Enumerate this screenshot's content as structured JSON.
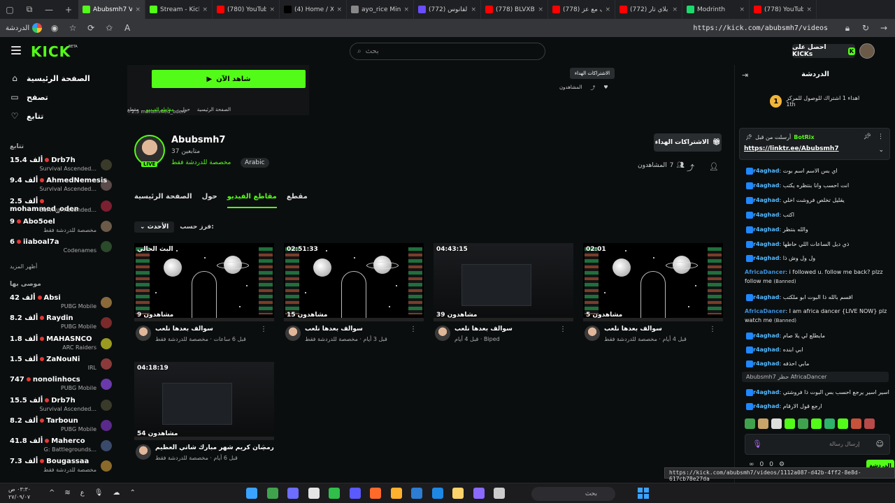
{
  "browser": {
    "tabs": [
      {
        "title": "Abubsmh7 Videos",
        "color": "#53fc18",
        "active": true
      },
      {
        "title": "Stream - Kick Dash",
        "color": "#53fc18",
        "active": false
      },
      {
        "title": "(780) YouTube",
        "color": "#ff0000",
        "active": false
      },
      {
        "title": "(4) Home / X",
        "color": "#000000",
        "active": false
      },
      {
        "title": "ayo_rice Minecraft",
        "color": "#888888",
        "active": false
      },
      {
        "title": "القانوس (772)",
        "color": "#6a4dff",
        "active": false
      },
      {
        "title": "(778) BLVXB - MU",
        "color": "#ff0000",
        "active": false
      },
      {
        "title": "(778) حروف مع عز",
        "color": "#ff0000",
        "active": false
      },
      {
        "title": "(772) بوبي بلاي تار",
        "color": "#ff0000",
        "active": false
      },
      {
        "title": "Modrinth",
        "color": "#1bd96a",
        "active": false
      },
      {
        "title": "(778) YouTube",
        "color": "#ff0000",
        "active": false
      }
    ],
    "profile_label": "الدردشة",
    "url": "https://kick.com/abubsmh7/videos",
    "status_url": "https://kick.com/abubsmh7/videos/1112a087-d42b-4ff2-8e8d-617cb78e27da"
  },
  "header": {
    "logo": "KICK",
    "beta": "BETA",
    "search_placeholder": "بحث",
    "kicks_label": "احصل على KICKs"
  },
  "sidebar": {
    "nav": [
      {
        "label": "الصفحة الرئيسية",
        "icon": "home-icon",
        "glyph": "⌂"
      },
      {
        "label": "تصفح",
        "icon": "browse-icon",
        "glyph": "▭"
      },
      {
        "label": "تتابع",
        "icon": "heart-icon",
        "glyph": "♡"
      }
    ],
    "following_title": "تتابع",
    "following": [
      {
        "name": "Drb7h",
        "viewers": "15.4 ألف",
        "category": "Survival Ascended...",
        "avatar": "#3a3a2a"
      },
      {
        "name": "AhmedNemesis",
        "viewers": "9.4 ألف",
        "category": "Survival Ascended...",
        "avatar": "#5a4a4a"
      },
      {
        "name": "mohammed_oden",
        "viewers": "2.5 ألف",
        "category": "Survival Ascended...",
        "avatar": "#7a2030"
      },
      {
        "name": "Abo5oel",
        "viewers": "9",
        "category": "مخصصة للدردشة فقط",
        "avatar": "#6b5a48"
      },
      {
        "name": "iiaboal7a",
        "viewers": "6",
        "category": "Codenames",
        "avatar": "#2a4a2a"
      }
    ],
    "show_more": "أظهر المزيد",
    "recommended_title": "موصى بها",
    "recommended": [
      {
        "name": "Absi",
        "viewers": "42 ألف",
        "category": "PUBG Mobile",
        "avatar": "#8a6a3a"
      },
      {
        "name": "Raydin",
        "viewers": "8.2 ألف",
        "category": "PUBG Mobile",
        "avatar": "#7a2a2a"
      },
      {
        "name": "MAHASNCO",
        "viewers": "1.8 ألف",
        "category": "ARC Raiders",
        "avatar": "#9a9a20"
      },
      {
        "name": "ZaNouNi",
        "viewers": "1.5 ألف",
        "category": "IRL",
        "avatar": "#8a3a3a"
      },
      {
        "name": "nonolinhocs",
        "viewers": "747",
        "category": "PUBG Mobile",
        "avatar": "#6a3aaa"
      },
      {
        "name": "Drb7h",
        "viewers": "15.5 ألف",
        "category": "Survival Ascended...",
        "avatar": "#3a3a2a"
      },
      {
        "name": "Tarboun",
        "viewers": "8.2 ألف",
        "category": "PUBG Mobile",
        "avatar": "#5a2a8a"
      },
      {
        "name": "Maherco",
        "viewers": "41.8 ألف",
        "category": "G: Battlegrounds...",
        "avatar": "#3a4a6a"
      },
      {
        "name": "Bougassaa",
        "viewers": "7.3 ألف",
        "category": "مخصصة للدردشة فقط",
        "avatar": "#8a6a2a"
      }
    ]
  },
  "mini_player": {
    "watch_now": "شاهد الآن",
    "tabs_strip": [
      "مقطع",
      "مقاطع الفيديو",
      "حول",
      "الصفحة الرئيسية"
    ],
    "streamer": "mohammed_oden",
    "viewers": "2.5",
    "category": "Survival Ascended...",
    "subs_label": "الاشتراكات الهداء",
    "viewers_label": "المشاهدون"
  },
  "channel": {
    "name": "Abubsmh7",
    "followers": "37 متابعين",
    "live": "LIVE",
    "category": "مخصصة للدردشة فقط",
    "language": "Arabic",
    "subs_button": "الاشتراكات الهداء",
    "viewers_label": "المشاهدون",
    "viewers": "7"
  },
  "tabs": [
    {
      "label": "مقطع",
      "active": false
    },
    {
      "label": "مقاطع الفيديو",
      "active": true
    },
    {
      "label": "حول",
      "active": false
    },
    {
      "label": "الصفحة الرئيسية",
      "active": false
    }
  ],
  "sort": {
    "label": "فرز حسب:",
    "value": "الأحدث"
  },
  "videos": [
    {
      "duration": "البث الحالي",
      "views": "9 مشاهدون",
      "title": "سوالف بعدها نلعب",
      "meta": "قبل 6 ساعات · مخصصة للدردشة فقط",
      "style": "space"
    },
    {
      "duration": "02:51:33",
      "views": "15 مشاهدون",
      "title": "سوالف بعدها نلعب",
      "meta": "قبل 3 أيام · مخصصة للدردشة فقط",
      "style": "space"
    },
    {
      "duration": "04:43:15",
      "views": "39 مشاهدون",
      "title": "سوالف بعدها نلعب",
      "meta": "قبل 4 أيام · Biped",
      "style": "dark"
    },
    {
      "duration": "02:01",
      "views": "5 مشاهدون",
      "title": "سوالف بعدها نلعب",
      "meta": "قبل 4 أيام · مخصصة للدردشة فقط",
      "style": "space"
    },
    {
      "duration": "04:18:19",
      "views": "54 مشاهدون",
      "title": "رمضان كريم شهر مبارك شاتي العظيم",
      "meta": "قبل 6 أيام · مخصصة للدردشة فقط",
      "style": "dark"
    }
  ],
  "chat": {
    "title": "الدردشة",
    "rank_text": "اهداء 1 اشتراك للوصول للمركز 1th",
    "rank_num": "1",
    "pinned_by": "أرسلت من قبل",
    "pinned_bot": "BotRix",
    "pinned_link": "https://linktr.ee/Abubsmh7",
    "messages": [
      {
        "user": "r4aghad",
        "color": "#53b8ff",
        "text": "اي بس الاسم اسم بوت",
        "banned": ""
      },
      {
        "user": "r4aghad",
        "color": "#53b8ff",
        "text": "انت احسب وانا بنتظره يكتب",
        "banned": ""
      },
      {
        "user": "r4aghad",
        "color": "#53b8ff",
        "text": "يقليل تخلص فروشت اخلي",
        "banned": ""
      },
      {
        "user": "r4aghad",
        "color": "#53b8ff",
        "text": "اكتب",
        "banned": ""
      },
      {
        "user": "r4aghad",
        "color": "#53b8ff",
        "text": "والله بنتظر",
        "banned": ""
      },
      {
        "user": "r4aghad",
        "color": "#53b8ff",
        "text": "ذي ديل الساعات اللي حاطها",
        "banned": ""
      },
      {
        "user": "r4aghad",
        "color": "#53b8ff",
        "text": "ول ول وش ذا",
        "banned": ""
      },
      {
        "user": "AfricaDancer",
        "color": "#3b8fd9",
        "text": "i followed u. follow me back? plzz follow me",
        "banned": "(Banned)"
      },
      {
        "user": "r4aghad",
        "color": "#53b8ff",
        "text": "اقسم بالله ذا البوت ابو ملكتب",
        "banned": ""
      },
      {
        "user": "AfricaDancer",
        "color": "#3b8fd9",
        "text": "I am africa dancer {LIVE NOW} plz watch me",
        "banned": "(Banned)"
      },
      {
        "user": "r4aghad",
        "color": "#53b8ff",
        "text": "مايطلع لي يلا صام",
        "banned": ""
      },
      {
        "user": "r4aghad",
        "color": "#53b8ff",
        "text": "ابي ابنده",
        "banned": ""
      },
      {
        "user": "r4aghad",
        "color": "#53b8ff",
        "text": "مابي احذفه",
        "banned": ""
      },
      {
        "user": "r4aghad",
        "color": "#53b8ff",
        "text": "اسير اسير يرجع احسب بس البوت ذا فروشتي",
        "banned": ""
      },
      {
        "user": "r4aghad",
        "color": "#53b8ff",
        "text": "ارجع قول الارقام",
        "banned": ""
      }
    ],
    "system_msg": "Abubsmh7 حظر AfricaDancer",
    "input_placeholder": "إرسال رسالة",
    "send": "الدردشة",
    "bottom": [
      "0",
      "0"
    ],
    "emotes": [
      "#3fa34d",
      "#c9a36a",
      "#ddd",
      "#53fc18",
      "#3fa34d",
      "#53fc18",
      "#2db36a",
      "#53fc18",
      "#c5523a",
      "#b84a4a"
    ]
  },
  "taskbar": {
    "time": "٠٣:٣٠ ص",
    "date": "٢٧/٠٩/٠٧",
    "search": "بحث",
    "apps": [
      "#3aa3ff",
      "#3fa34d",
      "#6d6dff",
      "#e5e5e5",
      "#2fbf4a",
      "#5a5aff",
      "#ff6a2a",
      "#ffb02e",
      "#2d7dd2",
      "#1e88e5",
      "#ffd36a",
      "#8a6aff",
      "#cccccc"
    ]
  }
}
